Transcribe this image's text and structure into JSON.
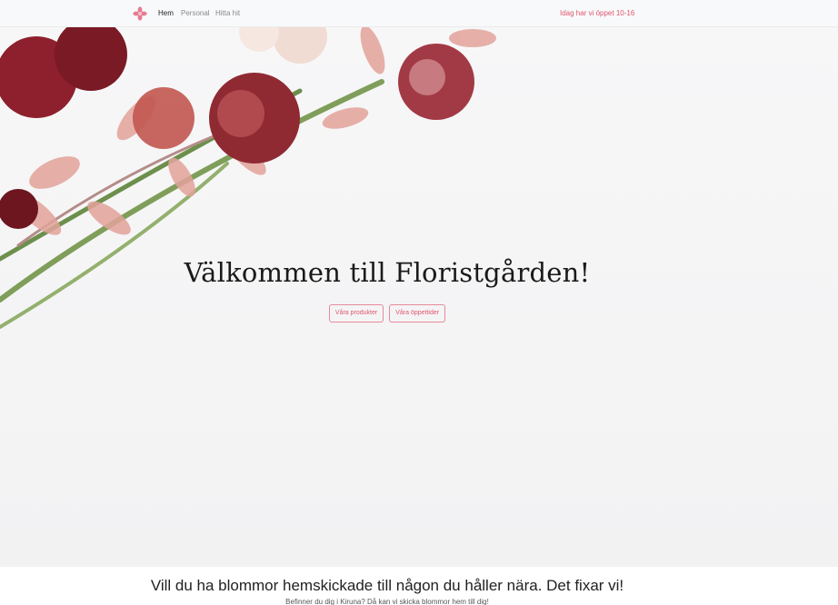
{
  "navbar": {
    "brand_icon": "flower-icon",
    "links": [
      {
        "label": "Hem",
        "active": true
      },
      {
        "label": "Personal",
        "active": false
      },
      {
        "label": "Hitta hit",
        "active": false
      }
    ],
    "open_hours": "Idag har vi öppet 10-16"
  },
  "hero": {
    "title": "Välkommen till Floristgården!",
    "buttons": {
      "products": "Våra produkter",
      "hours": "Våra öppettider"
    }
  },
  "delivery": {
    "title": "Vill du ha blommor hemskickade till någon du håller nära. Det fixar vi!",
    "subtitle": "Befinner du dig i Kiruna? Då kan vi skicka blommor hem till dig!"
  },
  "colors": {
    "accent": "#e0566f",
    "navbar_bg": "#f8f9fa",
    "hero_bg": "#f5f5f6"
  }
}
